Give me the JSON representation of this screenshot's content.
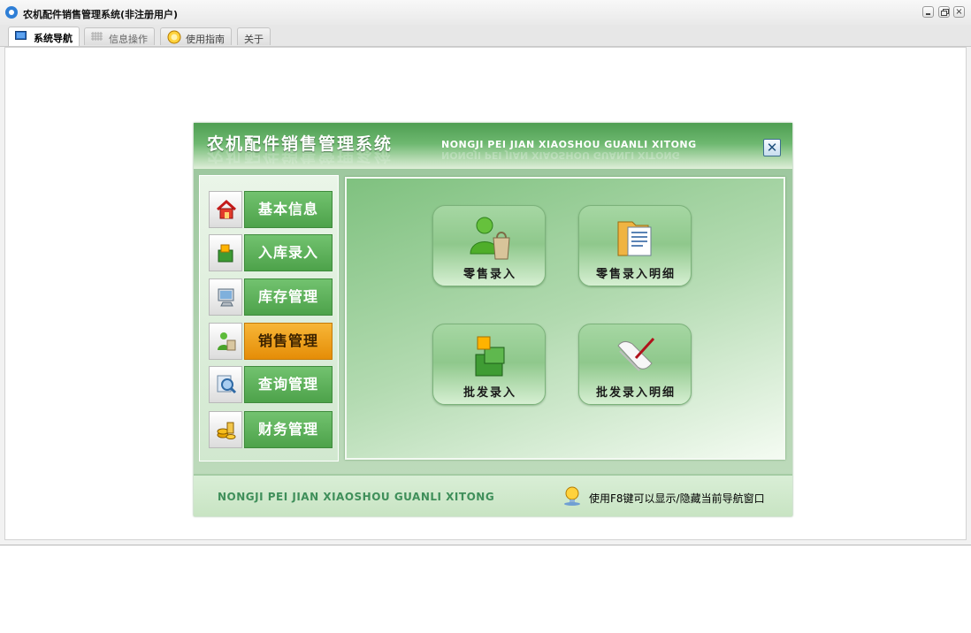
{
  "window": {
    "title": "农机配件销售管理系统(非注册用户)"
  },
  "tabs": [
    {
      "label": "系统导航",
      "icon": "monitor-icon"
    },
    {
      "label": "信息操作",
      "icon": "grid-icon"
    },
    {
      "label": "使用指南",
      "icon": "help-icon"
    },
    {
      "label": "关于",
      "icon": ""
    }
  ],
  "dialog": {
    "title": "农机配件销售管理系统",
    "subtitle": "NONGJI PEI JIAN XIAOSHOU GUANLI XITONG",
    "close_symbol": "✕",
    "menu": [
      {
        "label": "基本信息",
        "icon": "house-icon"
      },
      {
        "label": "入库录入",
        "icon": "box-icon"
      },
      {
        "label": "库存管理",
        "icon": "monitor-icon"
      },
      {
        "label": "销售管理",
        "icon": "user-bag-icon",
        "active": true
      },
      {
        "label": "查询管理",
        "icon": "magnifier-icon"
      },
      {
        "label": "财务管理",
        "icon": "coins-icon"
      }
    ],
    "actions": [
      {
        "label": "零售录入",
        "icon": "person-shopping-bag-icon"
      },
      {
        "label": "零售录入明细",
        "icon": "folder-document-icon"
      },
      {
        "label": "批发录入",
        "icon": "stacked-boxes-icon"
      },
      {
        "label": "批发录入明细",
        "icon": "scroll-pen-icon"
      }
    ],
    "footer": {
      "brand": "NONGJI PEI JIAN XIAOSHOU GUANLI XITONG",
      "hint": "使用F8键可以显示/隐藏当前导航窗口"
    }
  },
  "colors": {
    "header_green": "#4e9e52",
    "menu_green": "#5bb157",
    "menu_active_orange": "#f0a21c",
    "footer_text": "#3f8f5a"
  }
}
